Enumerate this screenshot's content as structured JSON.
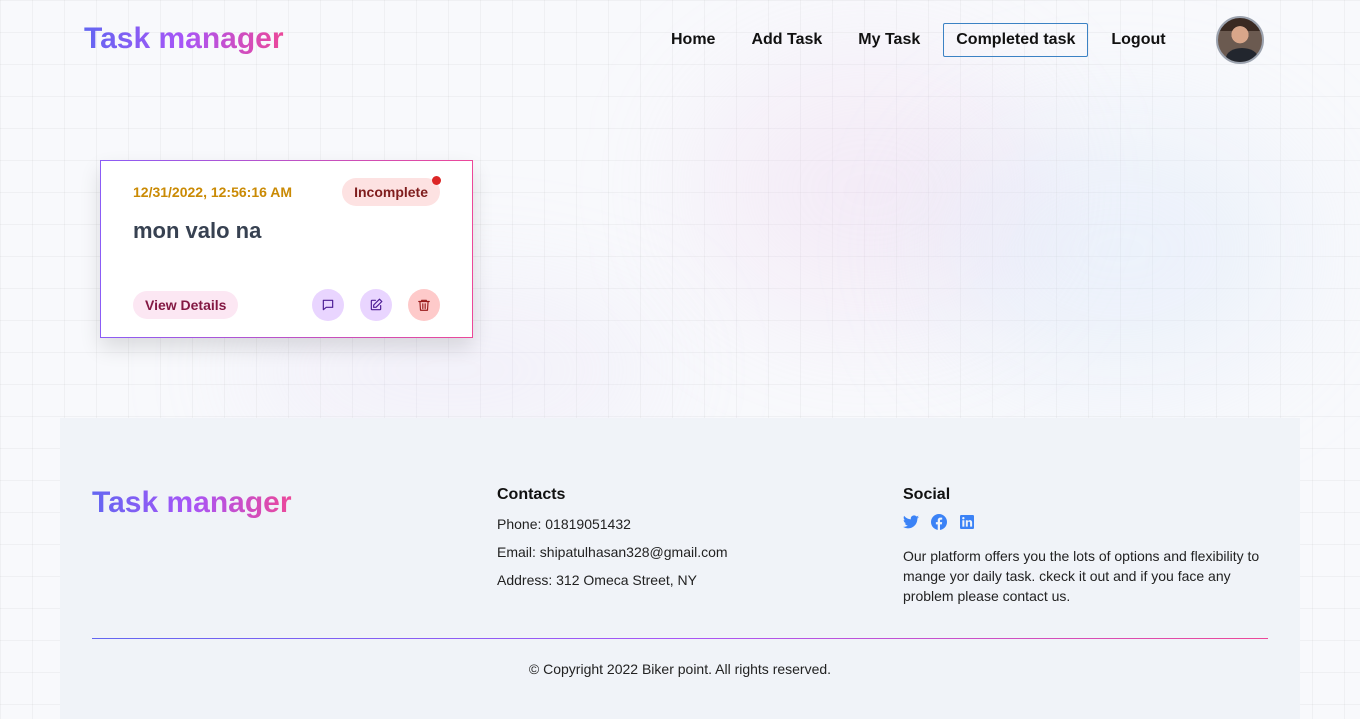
{
  "brand": "Task manager",
  "nav": {
    "items": [
      "Home",
      "Add Task",
      "My Task",
      "Completed task",
      "Logout"
    ],
    "active": "Completed task"
  },
  "task": {
    "date": "12/31/2022, 12:56:16 AM",
    "status": "Incomplete",
    "title": "mon valo na",
    "view_label": "View Details",
    "actions": [
      "comment-icon",
      "edit-icon",
      "trash-icon"
    ]
  },
  "footer": {
    "brand": "Task manager",
    "contacts_title": "Contacts",
    "phone": "Phone: 01819051432",
    "email": "Email: shipatulhasan328@gmail.com",
    "address": "Address: 312 Omeca Street, NY",
    "social_title": "Social",
    "social_icons": [
      "twitter-icon",
      "facebook-icon",
      "linkedin-icon"
    ],
    "about": "Our platform offers you the lots of options and flexibility to mange yor daily task. ckeck it out and if you face any problem please contact us.",
    "copyright": "© Copyright 2022 Biker point. All rights reserved."
  },
  "colors": {
    "brand_gradient": [
      "#6366f1",
      "#a855f7",
      "#ec4899"
    ],
    "date": "#ca8a04",
    "status_bg": "#fde2e2",
    "social": "#3b82f6",
    "nav_active_border": "#3b82c4"
  }
}
